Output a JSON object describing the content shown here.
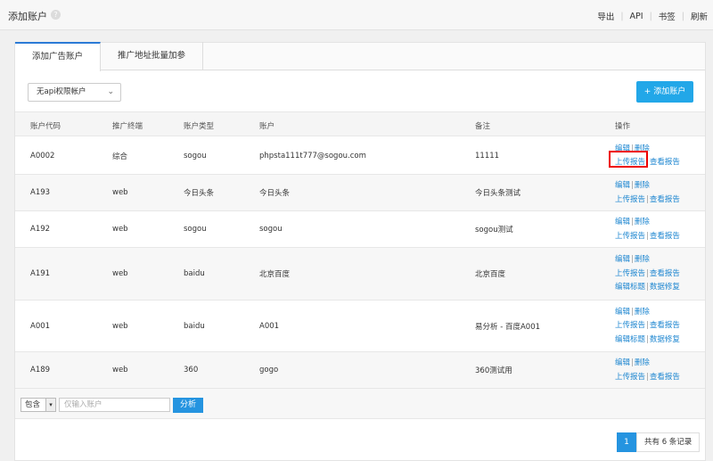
{
  "header": {
    "title": "添加账户",
    "links": [
      "导出",
      "API",
      "书签",
      "刷新"
    ]
  },
  "tabs": [
    "添加广告账户",
    "推广地址批量加参"
  ],
  "filter": {
    "selected": "无api权限帐户"
  },
  "add_button": "添加账户",
  "table": {
    "columns": [
      "账户代码",
      "推广终端",
      "账户类型",
      "账户",
      "备注",
      "操作"
    ],
    "rows": [
      {
        "code": "A0002",
        "terminal": "综合",
        "type": "sogou",
        "account": "phpsta111t777@sogou.com",
        "note": "11111",
        "ops": [
          [
            "编辑",
            "删除"
          ],
          [
            "上传报告",
            "查看报告"
          ]
        ]
      },
      {
        "code": "A193",
        "terminal": "web",
        "type": "今日头条",
        "account": "今日头条",
        "note": "今日头条测试",
        "ops": [
          [
            "编辑",
            "删除"
          ],
          [
            "上传报告",
            "查看报告"
          ]
        ]
      },
      {
        "code": "A192",
        "terminal": "web",
        "type": "sogou",
        "account": "sogou",
        "note": "sogou测试",
        "ops": [
          [
            "编辑",
            "删除"
          ],
          [
            "上传报告",
            "查看报告"
          ]
        ]
      },
      {
        "code": "A191",
        "terminal": "web",
        "type": "baidu",
        "account": "北京百度",
        "note": "北京百度",
        "ops": [
          [
            "编辑",
            "删除"
          ],
          [
            "上传报告",
            "查看报告"
          ],
          [
            "编辑标题",
            "数据修复"
          ]
        ]
      },
      {
        "code": "A001",
        "terminal": "web",
        "type": "baidu",
        "account": "A001",
        "note": "易分析 - 百度A001",
        "ops": [
          [
            "编辑",
            "删除"
          ],
          [
            "上传报告",
            "查看报告"
          ],
          [
            "编辑标题",
            "数据修复"
          ]
        ]
      },
      {
        "code": "A189",
        "terminal": "web",
        "type": "360",
        "account": "gogo",
        "note": "360测试用",
        "ops": [
          [
            "编辑",
            "删除"
          ],
          [
            "上传报告",
            "查看报告"
          ]
        ]
      }
    ]
  },
  "footer": {
    "contain_select": "包含",
    "search_placeholder": "仅输入账户",
    "analyze_button": "分析"
  },
  "pagination": {
    "current": "1",
    "total_text": "共有 6 条记录"
  }
}
